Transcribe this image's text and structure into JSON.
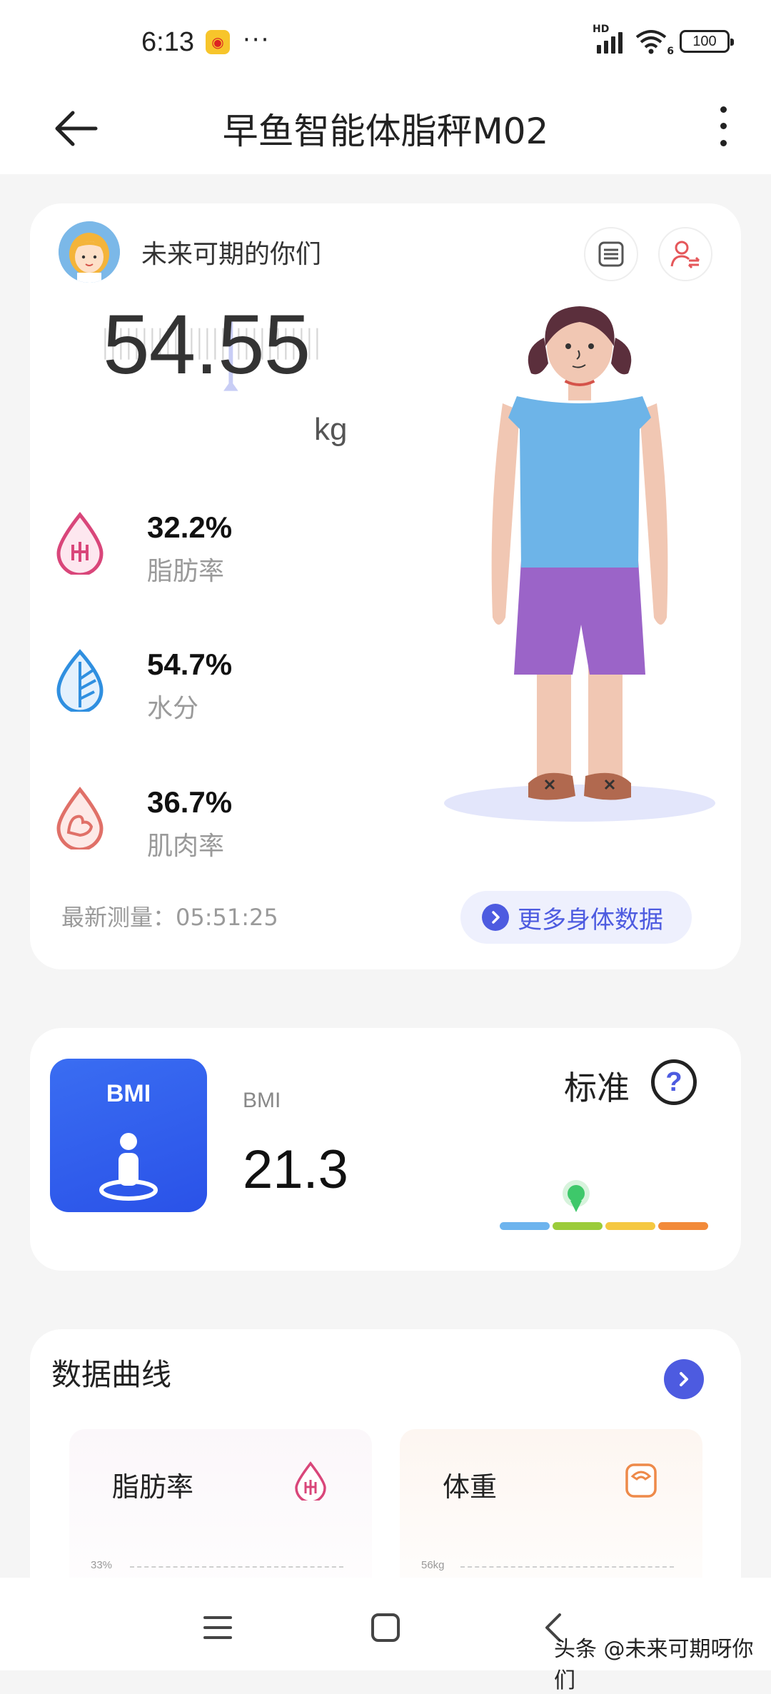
{
  "status_bar": {
    "time": "6:13",
    "weibo_icon": "weibo-icon",
    "more_indicator": "···",
    "network_label": "HD",
    "wifi_label": "6",
    "battery": "100"
  },
  "header": {
    "title": "早鱼智能体脂秤M02",
    "back_icon": "arrow-left-icon",
    "menu_icon": "more-vertical-icon"
  },
  "profile_card": {
    "username": "未来可期的你们",
    "weight_value": "54.55",
    "weight_unit": "kg",
    "metrics": [
      {
        "value": "32.2%",
        "label": "脂肪率",
        "icon": "fat-drop-icon",
        "color": "#d9467a"
      },
      {
        "value": "54.7%",
        "label": "水分",
        "icon": "water-leaf-icon",
        "color": "#2f8fe0"
      },
      {
        "value": "36.7%",
        "label": "肌肉率",
        "icon": "muscle-drop-icon",
        "color": "#e07068"
      }
    ],
    "last_measure": "最新测量：05:51:25",
    "more_data_button": "更多身体数据"
  },
  "bmi_card": {
    "tile_label": "BMI",
    "label": "BMI",
    "value": "21.3",
    "status": "标准",
    "help_icon": "?",
    "scale_colors": [
      "#6db4ee",
      "#9bcc3a",
      "#f5c842",
      "#f28a3a"
    ],
    "marker_position": 0.38
  },
  "curve_card": {
    "title": "数据曲线",
    "charts": [
      {
        "title": "脂肪率",
        "axis_label": "33%",
        "icon": "fat-drop-icon"
      },
      {
        "title": "体重",
        "axis_label": "56kg",
        "icon": "scale-icon"
      }
    ]
  },
  "watermark": "头条 @未来可期呀你们"
}
